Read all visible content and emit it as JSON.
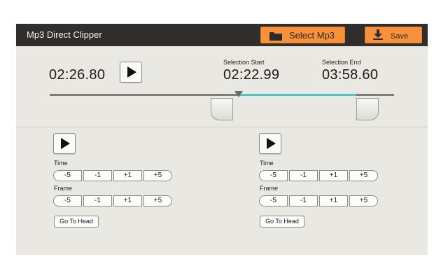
{
  "app": {
    "title": "Mp3 Direct Clipper",
    "select_label": "Select Mp3",
    "save_label": "Save"
  },
  "player": {
    "current_time": "02:26.80",
    "selection_start_label": "Selection Start",
    "selection_start": "02:22.99",
    "selection_end_label": "Selection End",
    "selection_end": "03:58.60"
  },
  "controls": {
    "left": {
      "time_label": "Time",
      "time_buttons": [
        "-5",
        "-1",
        "+1",
        "+5"
      ],
      "frame_label": "Frame",
      "frame_buttons": [
        "-5",
        "-1",
        "+1",
        "+5"
      ],
      "head_label": "Go To Head"
    },
    "right": {
      "time_label": "Time",
      "time_buttons": [
        "-5",
        "-1",
        "+1",
        "+5"
      ],
      "frame_label": "Frame",
      "frame_buttons": [
        "-5",
        "-1",
        "+1",
        "+5"
      ],
      "head_label": "Go To Head"
    }
  },
  "icons": {
    "select": "folder-icon",
    "save": "download-icon",
    "play": "play-icon"
  },
  "colors": {
    "accent": "#f7923a",
    "selection": "#4cc6c9",
    "titlebar": "#2f2e2c"
  }
}
